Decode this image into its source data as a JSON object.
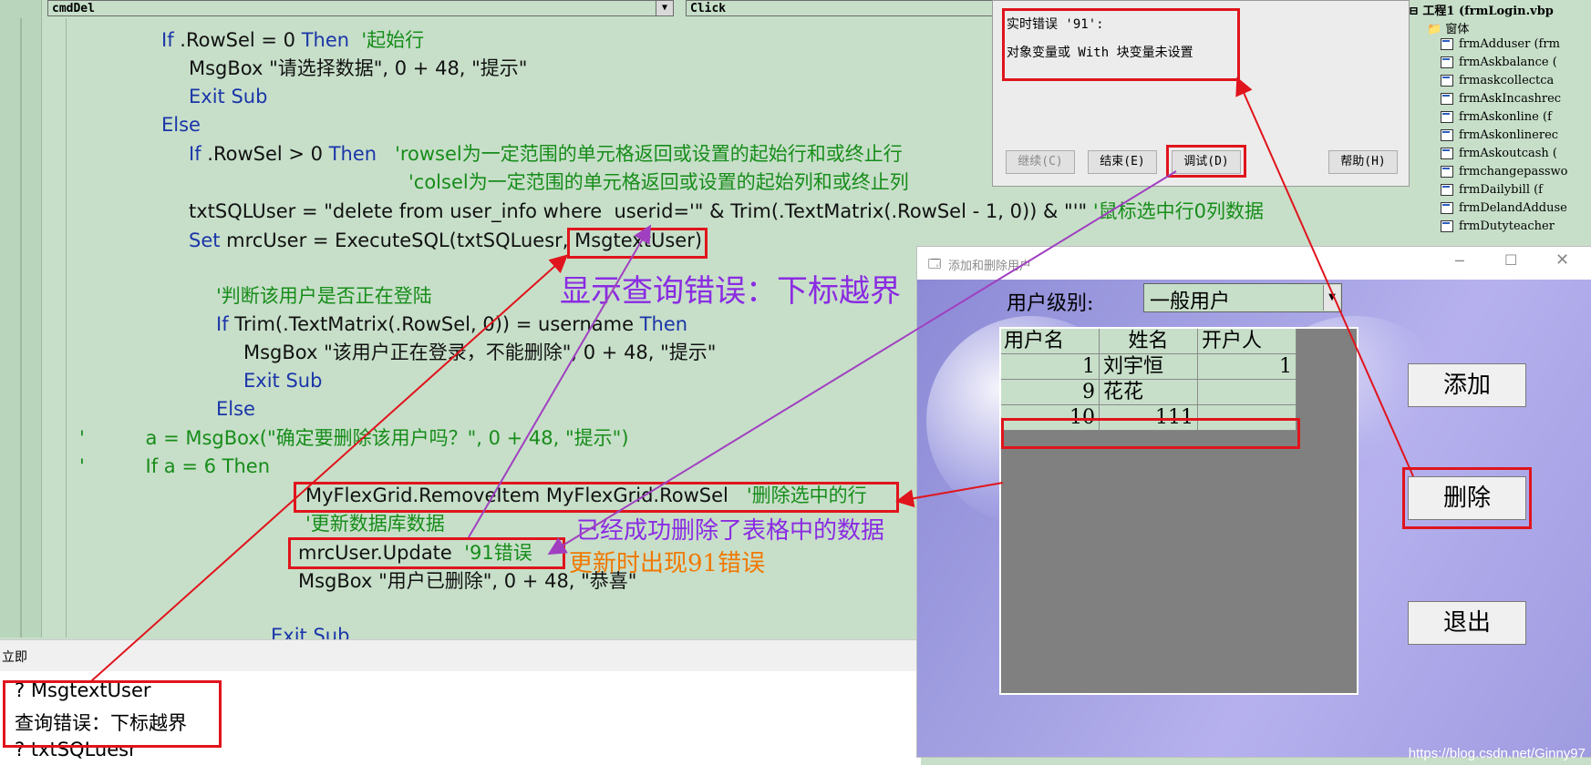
{
  "editor": {
    "object_combo": "cmdDel",
    "proc_combo": "Click",
    "lines": {
      "l1_kw": "If",
      "l1_code": " .RowSel = 0 ",
      "l1_then": "Then",
      "l1_cm": "  '起始行",
      "l2": "MsgBox \"请选择数据\", 0 + 48, \"提示\"",
      "l3": "Exit Sub",
      "l4": "Else",
      "l5_kw": "If",
      "l5_code": " .RowSel > 0 ",
      "l5_then": "Then",
      "l5_cm": "   'rowsel为一定范围的单元格返回或设置的起始行和或终止行",
      "l6_cm": "'colsel为一定范围的单元格返回或设置的起始列和或终止列",
      "l7_code": "txtSQLUser = \"delete from user_info where  userid='\" & Trim(.TextMatrix(.RowSel - 1, 0)) & \"'\" ",
      "l7_cm": "'鼠标选中行0列数据",
      "l8_kw": "Set",
      "l8_code": " mrcUser = ExecuteSQL(txtSQLuesr, ",
      "l8_box": "MsgtextUser)",
      "l9_cm": "'判断该用户是否正在登陆",
      "l10_kw": "If",
      "l10_code": " Trim(.TextMatrix(.RowSel, 0)) = username ",
      "l10_then": "Then",
      "l11": "MsgBox \"该用户正在登录，不能删除\", 0 + 48, \"提示\"",
      "l12": "Exit Sub",
      "l13": "Else",
      "l14_cm": "'          a = MsgBox(\"确定要删除该用户吗？\", 0 + 48, \"提示\")",
      "l15_cm": "'          If a = 6 Then",
      "l16_code": "MyFlexGrid.RemoveItem MyFlexGrid.RowSel   ",
      "l16_cm": "'删除选中的行",
      "l17_cm": "'更新数据库数据",
      "l18_code": "mrcUser.Update  ",
      "l18_cm": "'91错误",
      "l19": "MsgBox \"用户已删除\", 0 + 48, \"恭喜\"",
      "l20": "Exit Sub"
    }
  },
  "error_dialog": {
    "title": "实时错误 '91':",
    "message": "对象变量或 With 块变量未设置",
    "buttons": {
      "continue": "继续(C)",
      "end": "结束(E)",
      "debug": "调试(D)",
      "help": "帮助(H)"
    }
  },
  "project": {
    "root": "工程1 (frmLogin.vbp",
    "folder": "窗体",
    "forms": [
      "frmAdduser (frm",
      "frmAskbalance (",
      "frmaskcollectca",
      "frmAskIncashrec",
      "frmAskonline (f",
      "frmAskonlinerec",
      "frmAskoutcash (",
      "frmchangepasswo",
      "frmDailybill (f",
      "frmDelandAdduse",
      "frmDutyteacher"
    ]
  },
  "immediate": {
    "title": "立即",
    "lines": [
      "? MsgtextUser",
      "查询错误：下标越界",
      "? txtSQLuesr"
    ]
  },
  "form": {
    "title": "添加和删除用户",
    "level_label": "用户级别:",
    "level_value": "一般用户",
    "grid_headers": [
      "用户名",
      "姓名",
      "开户人"
    ],
    "grid_rows": [
      [
        "1",
        "刘宇恒",
        "1"
      ],
      [
        "9",
        "花花",
        ""
      ],
      [
        "10",
        "111",
        ""
      ]
    ],
    "buttons": {
      "add": "添加",
      "delete": "删除",
      "exit": "退出"
    }
  },
  "annotations": {
    "query_error": "显示查询错误：下标越界",
    "deleted_ok": "已经成功删除了表格中的数据",
    "update_error": "更新时出现91错误"
  },
  "colors": {
    "highlight_red": "#e0141c",
    "annotation_purple": "#8a2be2",
    "annotation_orange": "#f07800",
    "code_bg": "#c7dfc9"
  },
  "watermark": "https://blog.csdn.net/Ginny97"
}
